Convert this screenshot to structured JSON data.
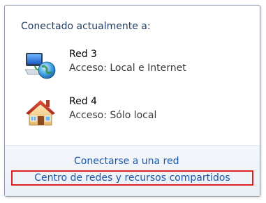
{
  "popup": {
    "header": "Conectado actualmente a:",
    "networks": [
      {
        "name": "Red 3",
        "access": "Acceso: Local e Internet",
        "icon": "network-internet-icon"
      },
      {
        "name": "Red 4",
        "access": "Acceso: Sólo local",
        "icon": "home-network-icon"
      }
    ],
    "links": {
      "connect": "Conectarse a una red",
      "network_center": "Centro de redes y recursos compartidos"
    }
  },
  "colors": {
    "link": "#1a56a8",
    "highlight_border": "#e02020",
    "header_text": "#1e395b"
  }
}
